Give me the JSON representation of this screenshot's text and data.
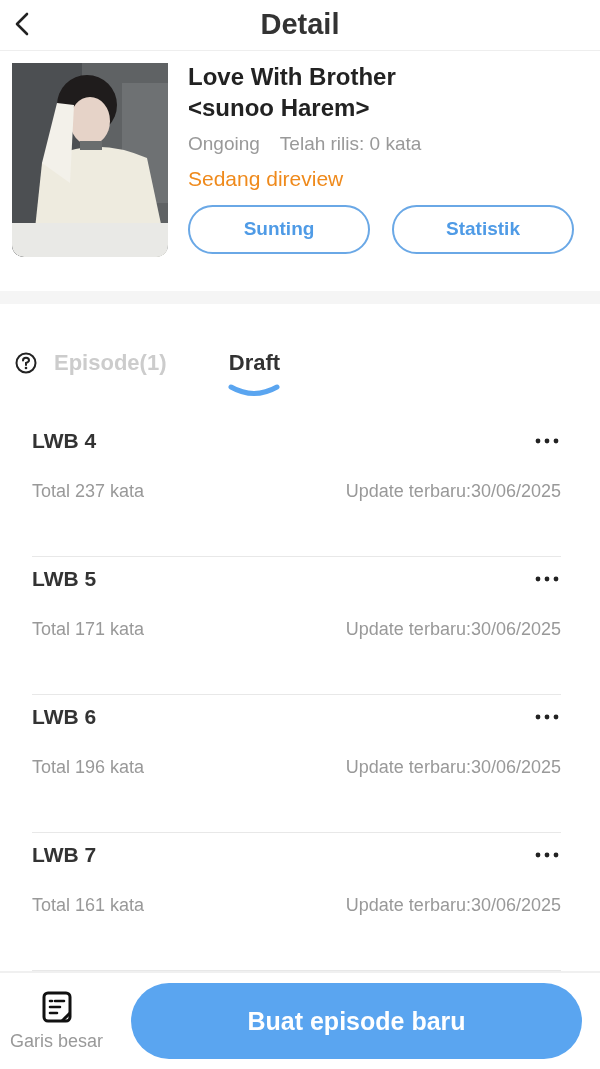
{
  "header": {
    "title": "Detail"
  },
  "book": {
    "title_lines": [
      "Love With Brother",
      "<sunoo Harem>"
    ],
    "progress": "Ongoing",
    "released": "Telah rilis: 0 kata",
    "review_status": "Sedang direview",
    "buttons": [
      "Sunting",
      "Statistik"
    ]
  },
  "tabs": [
    {
      "label": "Episode(1)",
      "selected": false
    },
    {
      "label": "Draft",
      "selected": true
    }
  ],
  "drafts": [
    {
      "title": "LWB 4",
      "words": "Total 237 kata",
      "updated": "Update terbaru:30/06/2025"
    },
    {
      "title": "LWB 5",
      "words": "Total 171 kata",
      "updated": "Update terbaru:30/06/2025"
    },
    {
      "title": "LWB 6",
      "words": "Total 196 kata",
      "updated": "Update terbaru:30/06/2025"
    },
    {
      "title": "LWB 7",
      "words": "Total 161 kata",
      "updated": "Update terbaru:30/06/2025"
    }
  ],
  "bottom_bar": {
    "outline_label": "Garis besar",
    "primary_button": "Buat episode baru"
  }
}
